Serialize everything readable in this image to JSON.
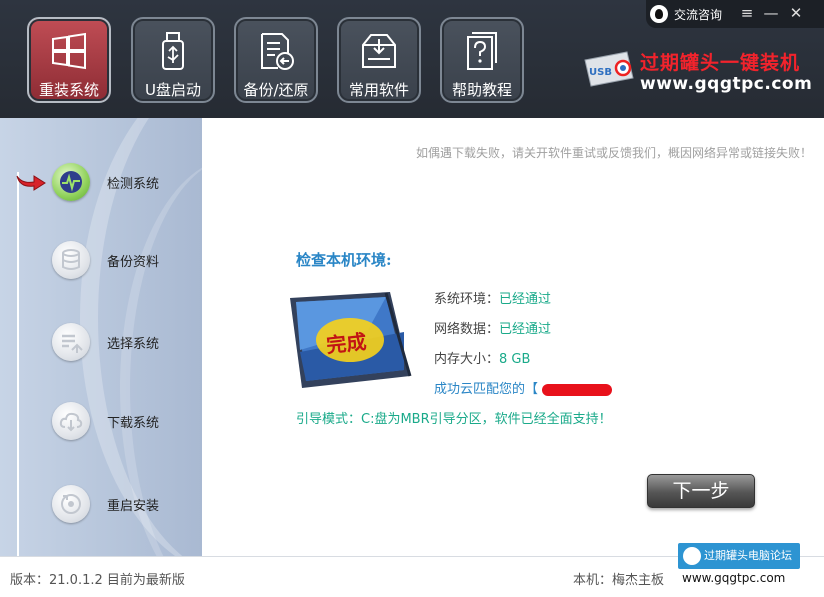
{
  "header": {
    "consult_label": "交流咨询",
    "window_controls": {
      "menu": "≡",
      "minimize": "—",
      "close": "✕"
    },
    "nav": [
      {
        "label": "重装系统",
        "icon": "windows-icon"
      },
      {
        "label": "U盘启动",
        "icon": "usb-drive-icon"
      },
      {
        "label": "备份/还原",
        "icon": "backup-restore-icon"
      },
      {
        "label": "常用软件",
        "icon": "software-box-icon"
      },
      {
        "label": "帮助教程",
        "icon": "help-document-icon"
      }
    ],
    "logo_badge": "USB",
    "brand_title": "过期罐头一键装机",
    "brand_url": "www.gqgtpc.com"
  },
  "sidebar": {
    "steps": [
      {
        "label": "检测系统",
        "icon": "detect-pulse-icon",
        "active": true
      },
      {
        "label": "备份资料",
        "icon": "database-icon"
      },
      {
        "label": "选择系统",
        "icon": "select-list-icon"
      },
      {
        "label": "下载系统",
        "icon": "cloud-download-icon"
      },
      {
        "label": "重启安装",
        "icon": "disk-restart-icon"
      }
    ]
  },
  "main": {
    "notice": "如偶遇下载失败，请关开软件重试或反馈我们，概因网络异常或链接失败！",
    "check_title": "检查本机环境:",
    "tablet_text": "完成",
    "rows": [
      {
        "label": "系统环境：",
        "value": "已经通过"
      },
      {
        "label": "网络数据：",
        "value": "已经通过"
      },
      {
        "label": "内存大小：",
        "value": "8 GB"
      }
    ],
    "match_text": "成功云匹配您的【",
    "boot_mode": "引导模式：C:盘为MBR引导分区，软件已经全面支持！",
    "next_button": "下一步"
  },
  "footer": {
    "version": "版本：21.0.1.2   目前为最新版",
    "machine": "本机：梅杰主板",
    "watermark_title": "过期罐头电脑论坛",
    "watermark_url": "www.gqgtpc.com"
  },
  "colors": {
    "header_bg": "#2a3038",
    "active_nav": "#a23a43",
    "brand_red": "#f2232c",
    "link_blue": "#2a86c6",
    "status_green": "#1aaa8a"
  }
}
